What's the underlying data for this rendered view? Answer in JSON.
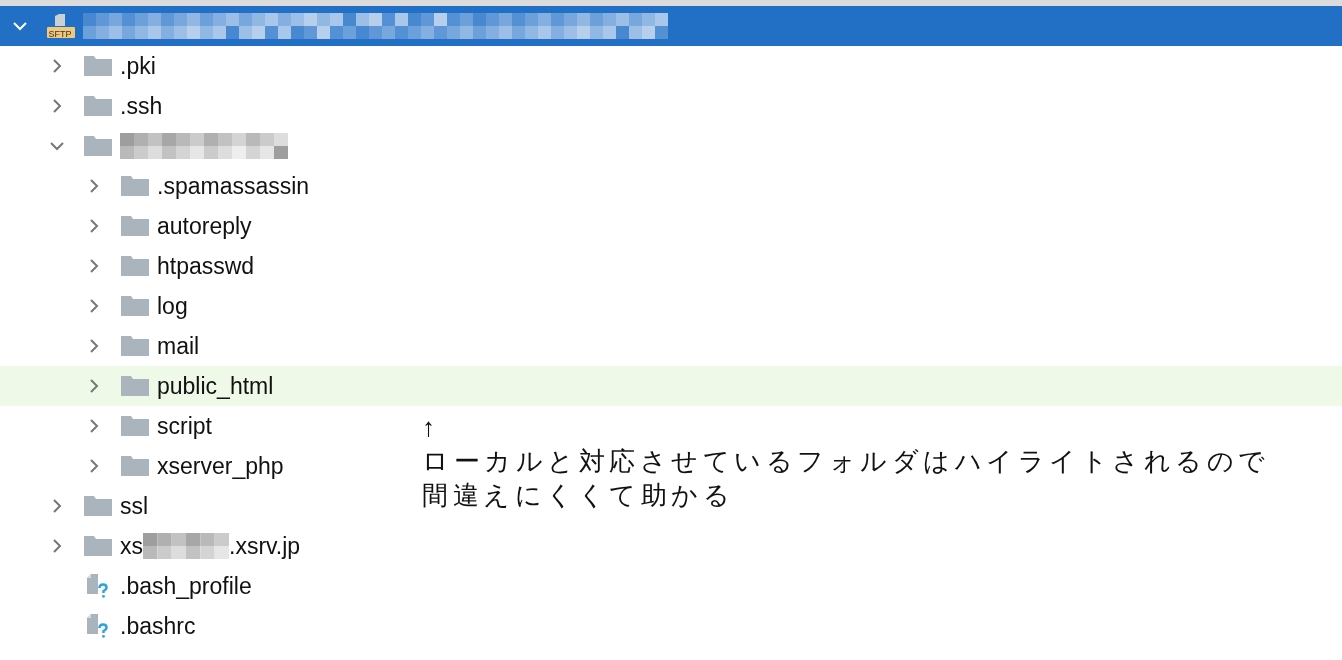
{
  "tree": {
    "kind": "sftp",
    "badge": "SFTP",
    "expanded": true,
    "selected": true,
    "highlighted": false,
    "parts": [
      {
        "kind": "blurred-long"
      }
    ],
    "children": [
      {
        "kind": "folder",
        "name": ".pki",
        "expanded": false,
        "selected": false,
        "highlighted": false
      },
      {
        "kind": "folder",
        "name": ".ssh",
        "expanded": false,
        "selected": false,
        "highlighted": false
      },
      {
        "kind": "folder",
        "parts": [
          {
            "kind": "blurred-medium"
          }
        ],
        "expanded": true,
        "selected": false,
        "highlighted": false,
        "children": [
          {
            "kind": "folder",
            "name": ".spamassassin",
            "expanded": false,
            "selected": false,
            "highlighted": false
          },
          {
            "kind": "folder",
            "name": "autoreply",
            "expanded": false,
            "selected": false,
            "highlighted": false
          },
          {
            "kind": "folder",
            "name": "htpasswd",
            "expanded": false,
            "selected": false,
            "highlighted": false
          },
          {
            "kind": "folder",
            "name": "log",
            "expanded": false,
            "selected": false,
            "highlighted": false
          },
          {
            "kind": "folder",
            "name": "mail",
            "expanded": false,
            "selected": false,
            "highlighted": false
          },
          {
            "kind": "folder",
            "name": "public_html",
            "expanded": false,
            "selected": false,
            "highlighted": true
          },
          {
            "kind": "folder",
            "name": "script",
            "expanded": false,
            "selected": false,
            "highlighted": false
          },
          {
            "kind": "folder",
            "name": "xserver_php",
            "expanded": false,
            "selected": false,
            "highlighted": false
          }
        ]
      },
      {
        "kind": "folder",
        "name": "ssl",
        "expanded": false,
        "selected": false,
        "highlighted": false
      },
      {
        "kind": "folder",
        "parts": [
          {
            "kind": "text",
            "text": "xs"
          },
          {
            "kind": "blurred-short"
          },
          {
            "kind": "text",
            "text": ".xsrv.jp"
          }
        ],
        "expanded": false,
        "selected": false,
        "highlighted": false
      },
      {
        "kind": "file",
        "name": ".bash_profile",
        "selected": false,
        "highlighted": false
      },
      {
        "kind": "file",
        "name": ".bashrc",
        "selected": false,
        "highlighted": false
      }
    ]
  },
  "annotation": {
    "arrow": "↑",
    "lines": [
      "ローカルと対応させているフォルダはハイライトされるので",
      "間違えにくくて助かる"
    ]
  }
}
